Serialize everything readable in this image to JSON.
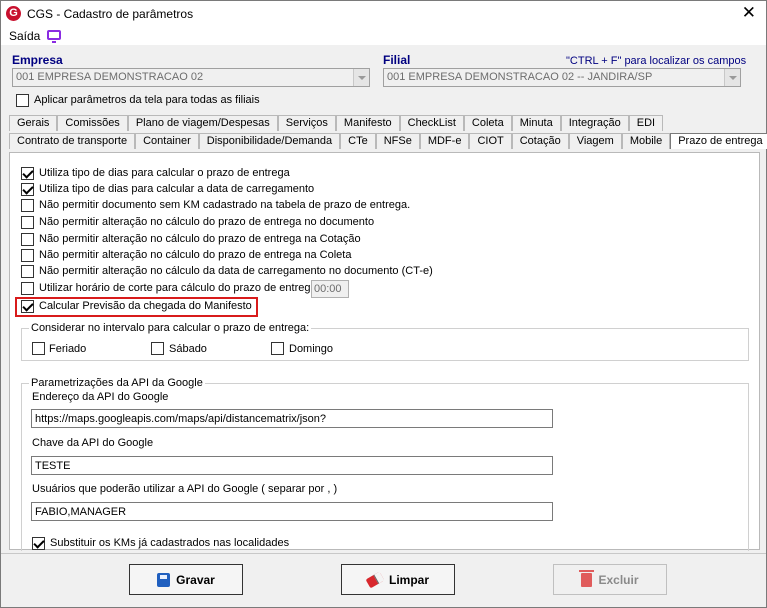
{
  "window": {
    "title": "CGS - Cadastro de parâmetros"
  },
  "menu": {
    "saida": "Saída"
  },
  "empresa": {
    "label": "Empresa",
    "value": "001 EMPRESA DEMONSTRACAO 02"
  },
  "filial": {
    "label": "Filial",
    "value": "001 EMPRESA DEMONSTRACAO 02 -- JANDIRA/SP"
  },
  "hint": "\"CTRL + F\" para localizar os campos",
  "aplicar": {
    "label": "Aplicar parâmetros da tela para todas as filiais",
    "checked": false
  },
  "tabs_row1": [
    "Gerais",
    "Comissões",
    "Plano de viagem/Despesas",
    "Serviços",
    "Manifesto",
    "CheckList",
    "Coleta",
    "Minuta",
    "Integração",
    "EDI"
  ],
  "tabs_row2": [
    "Contrato de transporte",
    "Container",
    "Disponibilidade/Demanda",
    "CTe",
    "NFSe",
    "MDF-e",
    "CIOT",
    "Cotação",
    "Viagem",
    "Mobile",
    "Prazo de entrega"
  ],
  "options": [
    {
      "label": "Utiliza tipo de dias para calcular o prazo de entrega",
      "checked": true
    },
    {
      "label": "Utiliza tipo de dias para calcular a data de carregamento",
      "checked": true
    },
    {
      "label": "Não permitir documento sem KM cadastrado na tabela de prazo de entrega.",
      "checked": false
    },
    {
      "label": "Não permitir alteração no cálculo do prazo de entrega no documento",
      "checked": false
    },
    {
      "label": "Não permitir alteração no cálculo do prazo de entrega na Cotação",
      "checked": false
    },
    {
      "label": "Não permitir alteração no cálculo do prazo de entrega na Coleta",
      "checked": false
    },
    {
      "label": "Não permitir alteração no cálculo da data de carregamento no documento (CT-e)",
      "checked": false
    },
    {
      "label": "Utilizar horário de corte para cálculo do prazo de entrega",
      "checked": false
    },
    {
      "label": "Calcular Previsão da chegada do Manifesto",
      "checked": true
    }
  ],
  "horario_corte": "00:00",
  "intervalo": {
    "title": "Considerar no intervalo para calcular o prazo de entrega:",
    "feriado": "Feriado",
    "sabado": "Sábado",
    "domingo": "Domingo"
  },
  "google": {
    "title": "Parametrizações da API da Google",
    "endereco_label": "Endereço da API do Google",
    "endereco_value": "https://maps.googleapis.com/maps/api/distancematrix/json?",
    "chave_label": "Chave da API do Google",
    "chave_value": "TESTE",
    "usuarios_label": "Usuários que poderão utilizar a API do Google ( separar por , )",
    "usuarios_value": "FABIO,MANAGER",
    "substituir_label": "Substituir os KMs já cadastrados nas localidades"
  },
  "buttons": {
    "gravar": "Gravar",
    "limpar": "Limpar",
    "excluir": "Excluir"
  },
  "colors": {
    "highlight": "#d81b1b",
    "label_blue": "#000080",
    "app_red": "#c8102e"
  }
}
